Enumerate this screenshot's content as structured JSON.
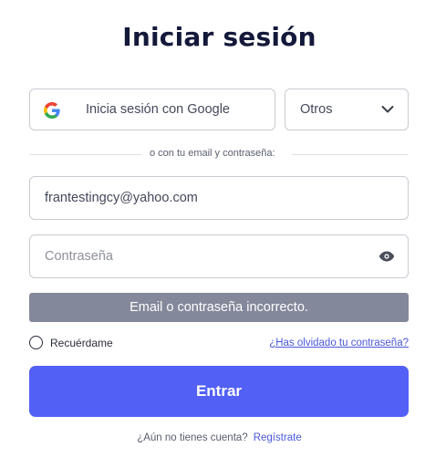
{
  "title": "Iniciar sesión",
  "social": {
    "google_label": "Inicia sesión con Google",
    "other_label": "Otros"
  },
  "divider_text": "o con tu email y contraseña:",
  "email": {
    "value": "frantestingcy@yahoo.com"
  },
  "password": {
    "placeholder": "Contraseña",
    "value": ""
  },
  "error_message": "Email o contraseña incorrecto.",
  "remember_label": "Recuérdame",
  "forgot_label": "¿Has olvidado tu contraseña?",
  "submit_label": "Entrar",
  "signup": {
    "prompt": "¿Aún no tienes cuenta?",
    "link": "Regístrate"
  },
  "colors": {
    "primary": "#5260f6",
    "title": "#14193a",
    "error_bg": "#83889a",
    "link": "#4b58d9"
  },
  "icons": [
    "google-icon",
    "chevron-down-icon",
    "eye-icon",
    "radio-icon"
  ]
}
